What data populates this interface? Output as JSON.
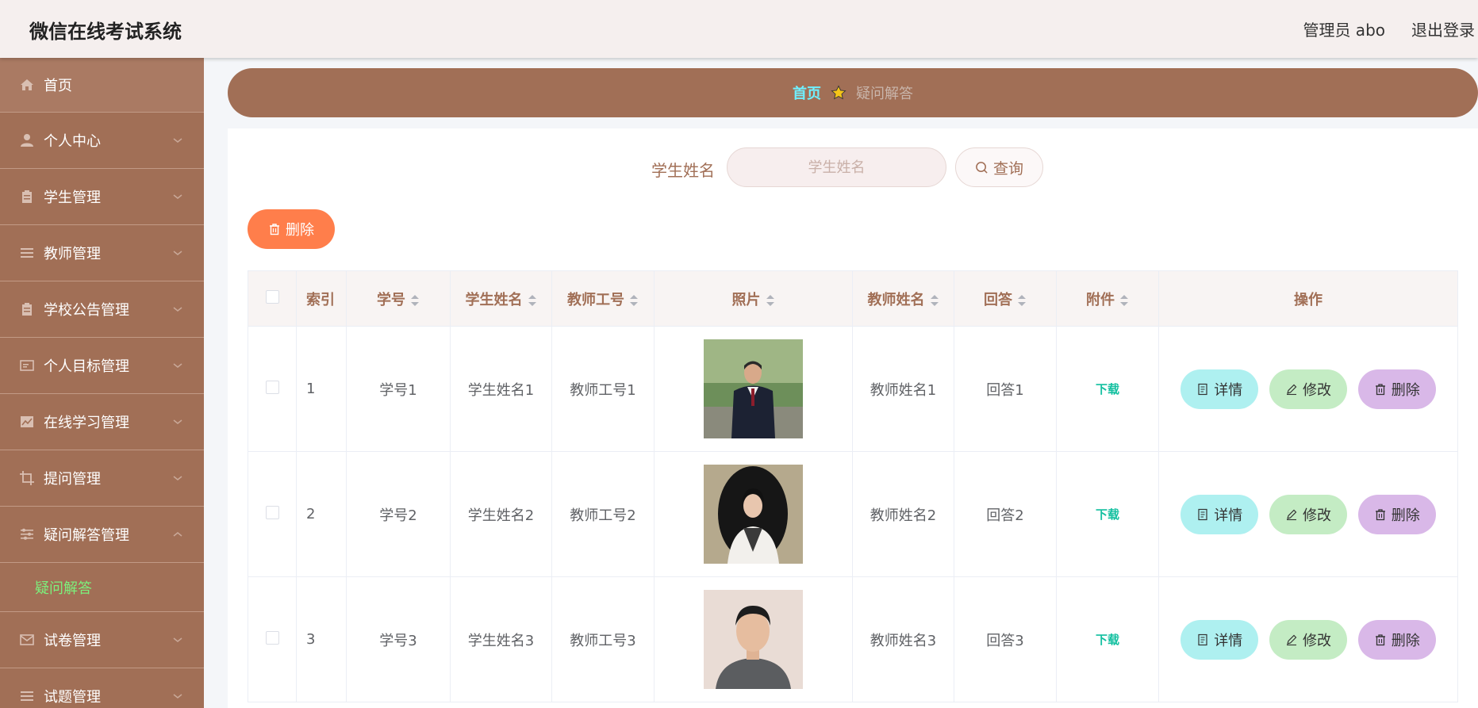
{
  "header": {
    "title": "微信在线考试系统",
    "admin": "管理员 abo",
    "logout": "退出登录"
  },
  "sidebar": {
    "items": [
      {
        "label": "首页",
        "icon": "home-icon"
      },
      {
        "label": "个人中心",
        "icon": "user-icon"
      },
      {
        "label": "学生管理",
        "icon": "clipboard-icon"
      },
      {
        "label": "教师管理",
        "icon": "list-icon"
      },
      {
        "label": "学校公告管理",
        "icon": "clipboard-icon"
      },
      {
        "label": "个人目标管理",
        "icon": "card-icon"
      },
      {
        "label": "在线学习管理",
        "icon": "chart-icon"
      },
      {
        "label": "提问管理",
        "icon": "crop-icon"
      },
      {
        "label": "疑问解答管理",
        "icon": "sliders-icon"
      },
      {
        "label": "试卷管理",
        "icon": "mail-icon"
      },
      {
        "label": "试题管理",
        "icon": "list-icon"
      }
    ],
    "submenu_label": "疑问解答"
  },
  "breadcrumb": {
    "home": "首页",
    "current": "疑问解答"
  },
  "search": {
    "label": "学生姓名",
    "placeholder": "学生姓名",
    "button": "查询"
  },
  "bulk_delete": "删除",
  "table": {
    "columns": [
      "索引",
      "学号",
      "学生姓名",
      "教师工号",
      "照片",
      "教师姓名",
      "回答",
      "附件",
      "操作"
    ],
    "rows": [
      {
        "index": "1",
        "student_no": "学号1",
        "student_name": "学生姓名1",
        "teacher_no": "教师工号1",
        "teacher_name": "教师姓名1",
        "answer": "回答1",
        "attachment": "下载"
      },
      {
        "index": "2",
        "student_no": "学号2",
        "student_name": "学生姓名2",
        "teacher_no": "教师工号2",
        "teacher_name": "教师姓名2",
        "answer": "回答2",
        "attachment": "下载"
      },
      {
        "index": "3",
        "student_no": "学号3",
        "student_name": "学生姓名3",
        "teacher_no": "教师工号3",
        "teacher_name": "教师姓名3",
        "answer": "回答3",
        "attachment": "下载"
      }
    ],
    "actions": {
      "detail": "详情",
      "edit": "修改",
      "delete": "删除"
    }
  },
  "colors": {
    "brand": "#a16f56",
    "accent_orange": "#ff7e4b",
    "active_submenu": "#7cf07c",
    "breadcrumb_home": "#6ff0ff",
    "download": "#13c0a0"
  }
}
